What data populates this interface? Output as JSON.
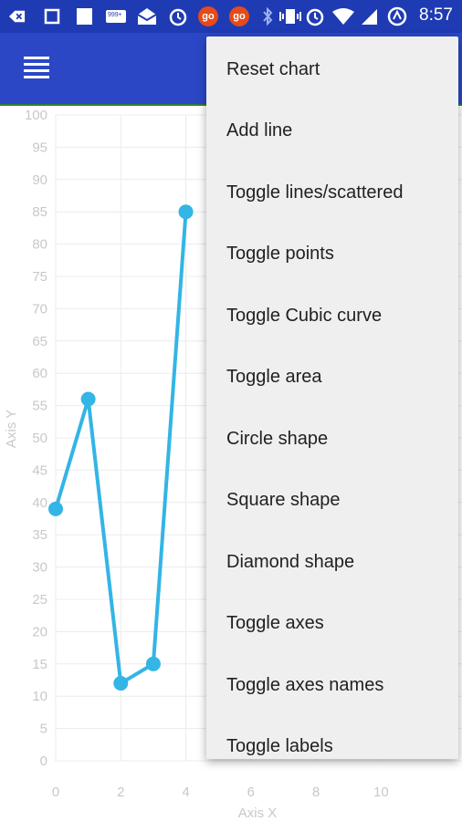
{
  "status_bar": {
    "time": "8:57",
    "icons": [
      "back-icon",
      "square-icon",
      "square-filled-icon",
      "notification-counter-icon",
      "mail-open-icon",
      "alarm-icon",
      "go-icon",
      "go-icon",
      "bluetooth-icon",
      "vibrate-icon",
      "alarm-icon",
      "wifi-icon",
      "signal-icon",
      "data-saver-icon"
    ],
    "badge_text": [
      "999+",
      "go",
      "go"
    ]
  },
  "app_bar": {
    "color": "#2b47c6",
    "menu_icon": "hamburger-icon"
  },
  "menu": {
    "items": [
      {
        "label": "Reset chart"
      },
      {
        "label": "Add line"
      },
      {
        "label": "Toggle lines/scattered"
      },
      {
        "label": "Toggle points"
      },
      {
        "label": "Toggle Cubic curve"
      },
      {
        "label": "Toggle area"
      },
      {
        "label": "Circle shape"
      },
      {
        "label": "Square shape"
      },
      {
        "label": "Diamond shape"
      },
      {
        "label": "Toggle axes"
      },
      {
        "label": "Toggle axes names"
      },
      {
        "label": "Toggle labels"
      }
    ]
  },
  "chart_data": {
    "type": "line",
    "xlabel": "Axis X",
    "ylabel": "Axis Y",
    "xlim": [
      0,
      11
    ],
    "ylim": [
      0,
      100
    ],
    "x_ticks": [
      "0",
      "2",
      "4",
      "6",
      "8",
      "10"
    ],
    "y_ticks": [
      "0",
      "5",
      "10",
      "15",
      "20",
      "25",
      "30",
      "35",
      "40",
      "45",
      "50",
      "55",
      "60",
      "65",
      "70",
      "75",
      "80",
      "85",
      "90",
      "95",
      "100"
    ],
    "grid": true,
    "series": [
      {
        "color": "#33b5e5",
        "points": [
          [
            0,
            39
          ],
          [
            1,
            56
          ],
          [
            2,
            12
          ],
          [
            3,
            15
          ],
          [
            4,
            85
          ]
        ]
      }
    ]
  }
}
